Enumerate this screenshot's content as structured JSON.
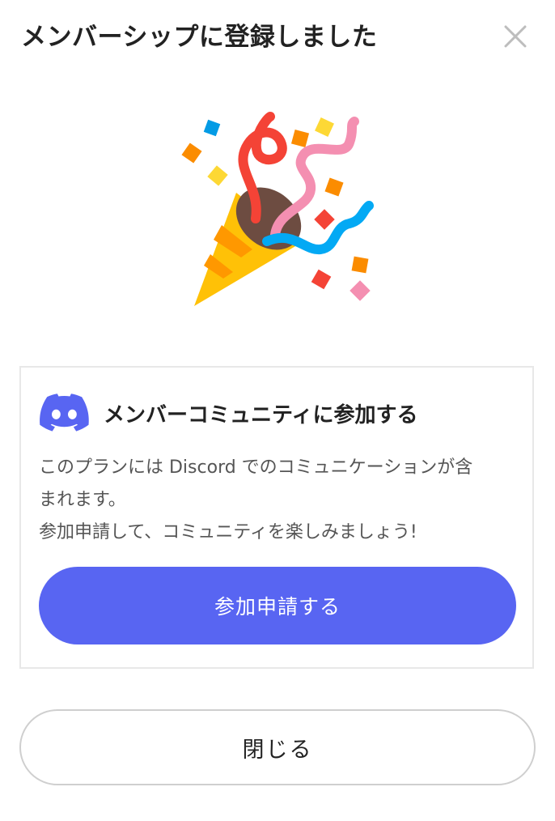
{
  "header": {
    "title": "メンバーシップに登録しました",
    "close_icon": "close-icon"
  },
  "hero": {
    "icon": "party-popper-icon"
  },
  "discord_card": {
    "icon": "discord-icon",
    "title": "メンバーコミュニティに参加する",
    "description_lines": [
      "このプランには Discord でのコミュニケーションが含",
      "まれます。",
      "参加申請して、コミュニティを楽しみましょう!"
    ],
    "join_button_label": "参加申請する"
  },
  "footer": {
    "close_button_label": "閉じる"
  },
  "colors": {
    "discord_blurple": "#5865F2",
    "text_primary": "#222222",
    "text_secondary": "#555555",
    "border": "#E8E8E8"
  }
}
